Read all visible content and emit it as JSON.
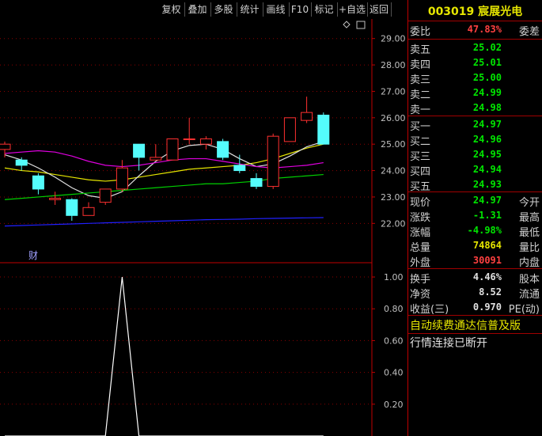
{
  "toolbar": {
    "buttons": [
      "复权",
      "叠加",
      "多股",
      "统计",
      "画线",
      "F10",
      "标记",
      "+自选",
      "返回"
    ]
  },
  "stock": {
    "code": "003019",
    "name": "宸展光电"
  },
  "weibi": {
    "label": "委比",
    "value": "47.83%",
    "label2": "委差"
  },
  "asks": [
    {
      "label": "卖五",
      "price": "25.02"
    },
    {
      "label": "卖四",
      "price": "25.01"
    },
    {
      "label": "卖三",
      "price": "25.00"
    },
    {
      "label": "卖二",
      "price": "24.99"
    },
    {
      "label": "卖一",
      "price": "24.98"
    }
  ],
  "bids": [
    {
      "label": "买一",
      "price": "24.97"
    },
    {
      "label": "买二",
      "price": "24.96"
    },
    {
      "label": "买三",
      "price": "24.95"
    },
    {
      "label": "买四",
      "price": "24.94"
    },
    {
      "label": "买五",
      "price": "24.93"
    }
  ],
  "quote": [
    {
      "label": "现价",
      "value": "24.97",
      "label2": "今开",
      "color": "#00e600"
    },
    {
      "label": "涨跌",
      "value": "-1.31",
      "label2": "最高",
      "color": "#00e600"
    },
    {
      "label": "涨幅",
      "value": "-4.98%",
      "label2": "最低",
      "color": "#00e600"
    },
    {
      "label": "总量",
      "value": "74864",
      "label2": "量比",
      "color": "#e6e600"
    },
    {
      "label": "外盘",
      "value": "30091",
      "label2": "内盘",
      "color": "#ff4040"
    }
  ],
  "fundamentals": [
    {
      "label": "换手",
      "value": "4.46%",
      "label2": "股本"
    },
    {
      "label": "净资",
      "value": "8.52",
      "label2": "流通"
    },
    {
      "label": "收益(三)",
      "value": "0.970",
      "label2": "PE(动)"
    }
  ],
  "notices": {
    "promo": "自动续费通达信普及版",
    "status": "行情连接已断开"
  },
  "main_chart": {
    "marker": "财",
    "price_axis": {
      "min": 21.5,
      "max": 29.5,
      "ticks": [
        "29.00",
        "28.00",
        "27.00",
        "26.00",
        "25.00",
        "24.00",
        "23.00",
        "22.00"
      ]
    },
    "candles": [
      {
        "o": 24.8,
        "c": 25.0,
        "h": 25.1,
        "l": 24.5
      },
      {
        "o": 24.4,
        "c": 24.2,
        "h": 24.5,
        "l": 24.0
      },
      {
        "o": 23.8,
        "c": 23.3,
        "h": 23.9,
        "l": 23.1
      },
      {
        "o": 22.9,
        "c": 22.95,
        "h": 23.2,
        "l": 22.7
      },
      {
        "o": 22.9,
        "c": 22.3,
        "h": 22.95,
        "l": 22.1
      },
      {
        "o": 22.3,
        "c": 22.6,
        "h": 22.8,
        "l": 22.3
      },
      {
        "o": 22.8,
        "c": 23.3,
        "h": 23.3,
        "l": 22.7
      },
      {
        "o": 23.3,
        "c": 24.1,
        "h": 24.4,
        "l": 23.2
      },
      {
        "o": 25.0,
        "c": 24.5,
        "h": 25.0,
        "l": 24.0
      },
      {
        "o": 24.4,
        "c": 24.5,
        "h": 25.0,
        "l": 24.4
      },
      {
        "o": 24.4,
        "c": 25.2,
        "h": 25.2,
        "l": 24.4
      },
      {
        "o": 25.2,
        "c": 25.2,
        "h": 26.0,
        "l": 25.0
      },
      {
        "o": 25.0,
        "c": 25.2,
        "h": 25.3,
        "l": 24.8
      },
      {
        "o": 25.1,
        "c": 24.5,
        "h": 25.2,
        "l": 24.4
      },
      {
        "o": 24.2,
        "c": 24.0,
        "h": 24.6,
        "l": 23.9
      },
      {
        "o": 23.7,
        "c": 23.4,
        "h": 23.9,
        "l": 23.3
      },
      {
        "o": 23.4,
        "c": 25.3,
        "h": 25.4,
        "l": 23.3
      },
      {
        "o": 25.1,
        "c": 26.0,
        "h": 26.0,
        "l": 25.1
      },
      {
        "o": 25.9,
        "c": 26.2,
        "h": 26.8,
        "l": 25.8
      },
      {
        "o": 26.1,
        "c": 25.0,
        "h": 26.2,
        "l": 25.0
      }
    ],
    "ma_lines": [
      {
        "color": "#e6e600",
        "values": [
          24.1,
          24.0,
          23.95,
          23.85,
          23.75,
          23.65,
          23.6,
          23.65,
          23.75,
          23.85,
          23.95,
          24.05,
          24.1,
          24.15,
          24.2,
          24.3,
          24.45,
          24.65,
          24.85,
          25.0
        ]
      },
      {
        "color": "#e0e0e0",
        "values": [
          24.6,
          24.4,
          24.1,
          23.75,
          23.35,
          23.05,
          22.95,
          23.2,
          23.8,
          24.35,
          24.75,
          24.95,
          25.0,
          24.8,
          24.45,
          24.15,
          24.25,
          24.55,
          24.9,
          25.1
        ]
      },
      {
        "color": "#e000e0",
        "values": [
          24.65,
          24.7,
          24.75,
          24.7,
          24.55,
          24.35,
          24.2,
          24.15,
          24.2,
          24.3,
          24.4,
          24.45,
          24.45,
          24.35,
          24.25,
          24.15,
          24.1,
          24.15,
          24.2,
          24.3
        ]
      },
      {
        "color": "#00d000",
        "values": [
          22.9,
          22.95,
          23.0,
          23.05,
          23.1,
          23.15,
          23.2,
          23.25,
          23.3,
          23.35,
          23.4,
          23.45,
          23.5,
          23.5,
          23.55,
          23.6,
          23.7,
          23.75,
          23.8,
          23.85
        ]
      },
      {
        "color": "#2020ff",
        "values": [
          21.9,
          21.92,
          21.94,
          21.96,
          21.98,
          22.0,
          22.02,
          22.04,
          22.06,
          22.08,
          22.1,
          22.12,
          22.14,
          22.15,
          22.16,
          22.18,
          22.19,
          22.2,
          22.21,
          22.22
        ]
      }
    ]
  },
  "sub_chart": {
    "axis": {
      "min": 0,
      "max": 1.05,
      "ticks": [
        "1.00",
        "0.80",
        "0.60",
        "0.40",
        "0.20"
      ]
    },
    "values": [
      0,
      0,
      0,
      0,
      0,
      0,
      0,
      1.0,
      0,
      0,
      0,
      0,
      0,
      0,
      0,
      0,
      0,
      0,
      0,
      0
    ]
  }
}
